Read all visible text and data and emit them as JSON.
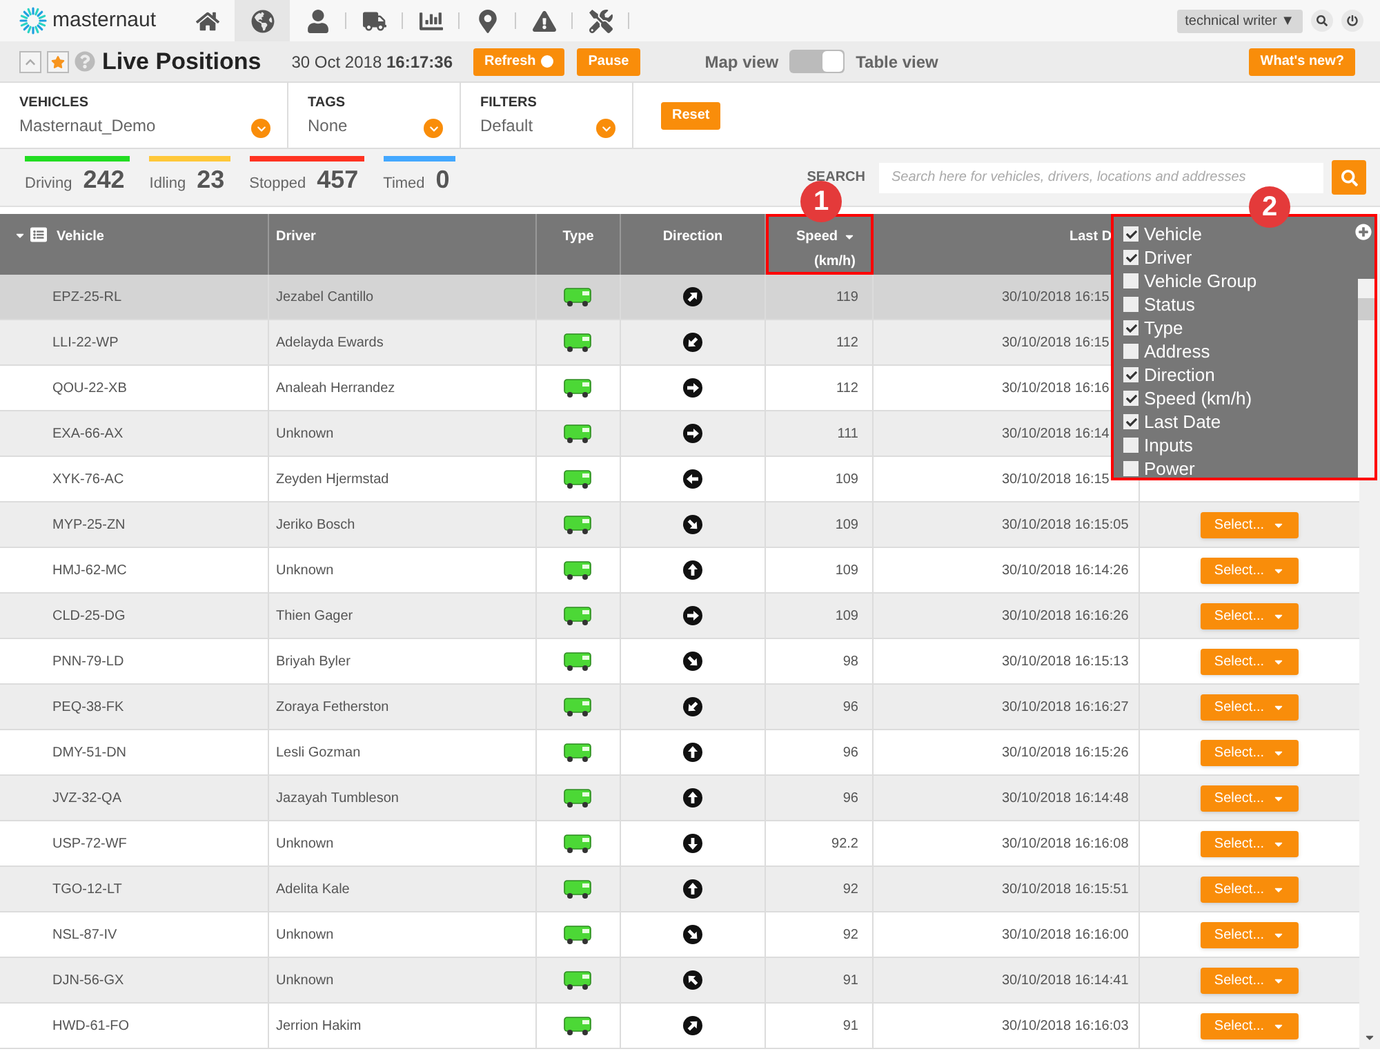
{
  "logo": {
    "text": "masternaut"
  },
  "nav": [
    {
      "kind": "home",
      "selected": false
    },
    {
      "kind": "globe",
      "selected": true
    },
    {
      "kind": "user",
      "selected": false
    },
    {
      "kind": "truck",
      "selected": false
    },
    {
      "kind": "chart",
      "selected": false
    },
    {
      "kind": "pin",
      "selected": false
    },
    {
      "kind": "warning",
      "selected": false
    },
    {
      "kind": "tools",
      "selected": false
    }
  ],
  "user_menu": {
    "label": "technical writer ▼"
  },
  "title_bar": {
    "title": "Live Positions",
    "date": "30 Oct 2018 **16:17:36**",
    "refresh": "Refresh",
    "pause": "Pause",
    "view_toggle": {
      "left": "Map view",
      "right": "Table view",
      "on": true
    },
    "whats_new": "What's new?"
  },
  "filters": [
    {
      "label": "VEHICLES",
      "value": "Masternaut_Demo"
    },
    {
      "label": "TAGS",
      "value": "None"
    },
    {
      "label": "FILTERS",
      "value": "Default"
    }
  ],
  "reset": "Reset",
  "stats": [
    {
      "label": "Driving",
      "count": "242",
      "color": "#22dd22"
    },
    {
      "label": "Idling",
      "count": "23",
      "color": "#ffc83a"
    },
    {
      "label": "Stopped",
      "count": "457",
      "color": "#ff3322"
    },
    {
      "label": "Timed",
      "count": "0",
      "color": "#44a8ff"
    }
  ],
  "search": {
    "label": "SEARCH",
    "placeholder": "Search here for vehicles, drivers, locations and addresses"
  },
  "table": {
    "columns": [
      {
        "label": "Vehicle",
        "highlighted": false
      },
      {
        "label": "Driver",
        "highlighted": false
      },
      {
        "label": "Type",
        "highlighted": false
      },
      {
        "label": "Direction",
        "highlighted": false
      },
      {
        "label": "Speed",
        "sublabel": "(km/h)",
        "highlighted": true
      },
      {
        "label": "Last D",
        "highlighted": false
      }
    ],
    "rows": [
      {
        "vehicle": "EPZ-25-RL",
        "driver": "Jezabel Cantillo",
        "direction": {
          "kind": "ne"
        },
        "speed": "119",
        "last_date": "30/10/2018 16:15",
        "selected": true
      },
      {
        "vehicle": "LLI-22-WP",
        "driver": "Adelayda Ewards",
        "direction": {
          "kind": "sw"
        },
        "speed": "112",
        "last_date": "30/10/2018 16:15",
        "selected": false
      },
      {
        "vehicle": "QOU-22-XB",
        "driver": "Analeah Herrandez",
        "direction": {
          "kind": "e"
        },
        "speed": "112",
        "last_date": "30/10/2018 16:16",
        "selected": false
      },
      {
        "vehicle": "EXA-66-AX",
        "driver": "Unknown",
        "direction": {
          "kind": "e"
        },
        "speed": "111",
        "last_date": "30/10/2018 16:14",
        "selected": false
      },
      {
        "vehicle": "XYK-76-AC",
        "driver": "Zeyden Hjermstad",
        "direction": {
          "kind": "w"
        },
        "speed": "109",
        "last_date": "30/10/2018 16:15",
        "selected": false
      },
      {
        "vehicle": "MYP-25-ZN",
        "driver": "Jeriko Bosch",
        "direction": {
          "kind": "se"
        },
        "speed": "109",
        "last_date": "30/10/2018 16:15:05",
        "action": "Select...",
        "selected": false
      },
      {
        "vehicle": "HMJ-62-MC",
        "driver": "Unknown",
        "direction": {
          "kind": "n"
        },
        "speed": "109",
        "last_date": "30/10/2018 16:14:26",
        "action": "Select...",
        "selected": false
      },
      {
        "vehicle": "CLD-25-DG",
        "driver": "Thien Gager",
        "direction": {
          "kind": "e"
        },
        "speed": "109",
        "last_date": "30/10/2018 16:16:26",
        "action": "Select...",
        "selected": false
      },
      {
        "vehicle": "PNN-79-LD",
        "driver": "Briyah Byler",
        "direction": {
          "kind": "se"
        },
        "speed": "98",
        "last_date": "30/10/2018 16:15:13",
        "action": "Select...",
        "selected": false
      },
      {
        "vehicle": "PEQ-38-FK",
        "driver": "Zoraya Fetherston",
        "direction": {
          "kind": "sw"
        },
        "speed": "96",
        "last_date": "30/10/2018 16:16:27",
        "action": "Select...",
        "selected": false
      },
      {
        "vehicle": "DMY-51-DN",
        "driver": "Lesli Gozman",
        "direction": {
          "kind": "n"
        },
        "speed": "96",
        "last_date": "30/10/2018 16:15:26",
        "action": "Select...",
        "selected": false
      },
      {
        "vehicle": "JVZ-32-QA",
        "driver": "Jazayah Tumbleson",
        "direction": {
          "kind": "n"
        },
        "speed": "96",
        "last_date": "30/10/2018 16:14:48",
        "action": "Select...",
        "selected": false
      },
      {
        "vehicle": "USP-72-WF",
        "driver": "Unknown",
        "direction": {
          "kind": "s"
        },
        "speed": "92.2",
        "last_date": "30/10/2018 16:16:08",
        "action": "Select...",
        "selected": false
      },
      {
        "vehicle": "TGO-12-LT",
        "driver": "Adelita Kale",
        "direction": {
          "kind": "n"
        },
        "speed": "92",
        "last_date": "30/10/2018 16:15:51",
        "action": "Select...",
        "selected": false
      },
      {
        "vehicle": "NSL-87-IV",
        "driver": "Unknown",
        "direction": {
          "kind": "se"
        },
        "speed": "92",
        "last_date": "30/10/2018 16:16:00",
        "action": "Select...",
        "selected": false
      },
      {
        "vehicle": "DJN-56-GX",
        "driver": "Unknown",
        "direction": {
          "kind": "nw"
        },
        "speed": "91",
        "last_date": "30/10/2018 16:14:41",
        "action": "Select...",
        "selected": false
      },
      {
        "vehicle": "HWD-61-FO",
        "driver": "Jerrion Hakim",
        "direction": {
          "kind": "ne"
        },
        "speed": "91",
        "last_date": "30/10/2018 16:16:03",
        "action": "Select...",
        "selected": false
      }
    ]
  },
  "column_chooser": {
    "highlighted": true,
    "items": [
      {
        "label": "Vehicle",
        "checked": true
      },
      {
        "label": "Driver",
        "checked": true
      },
      {
        "label": "Vehicle Group",
        "checked": false
      },
      {
        "label": "Status",
        "checked": false
      },
      {
        "label": "Type",
        "checked": true
      },
      {
        "label": "Address",
        "checked": false
      },
      {
        "label": "Direction",
        "checked": true
      },
      {
        "label": "Speed (km/h)",
        "checked": true
      },
      {
        "label": "Last Date",
        "checked": true
      },
      {
        "label": "Inputs",
        "checked": false
      },
      {
        "label": "Power",
        "checked": false
      }
    ]
  },
  "callouts": [
    "1",
    "2"
  ]
}
